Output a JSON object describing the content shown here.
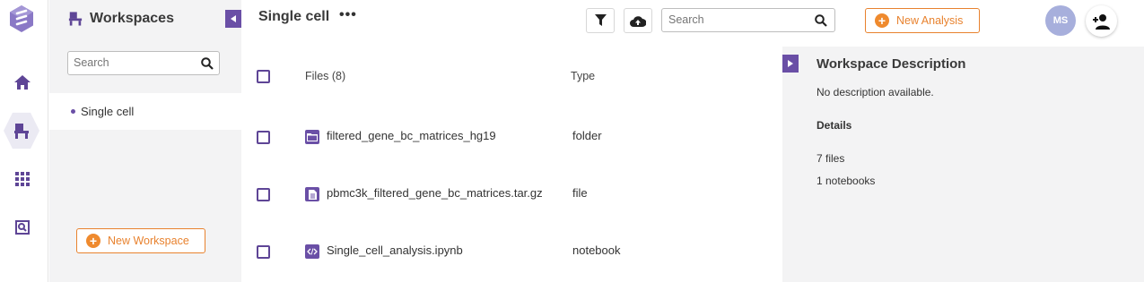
{
  "rail": {
    "items": [
      {
        "icon": "home-icon"
      },
      {
        "icon": "workspaces-icon",
        "active": true
      },
      {
        "icon": "apps-grid-icon"
      },
      {
        "icon": "data-explorer-icon"
      }
    ]
  },
  "workspaces": {
    "title": "Workspaces",
    "search_placeholder": "Search",
    "items": [
      {
        "label": "Single cell",
        "selected": true
      }
    ],
    "new_button": "New Workspace"
  },
  "header": {
    "title": "Single cell",
    "more": "•••",
    "search_placeholder": "Search",
    "new_analysis": "New Analysis",
    "avatar_initials": "MS"
  },
  "files": {
    "columns": {
      "name": "Files (8)",
      "type": "Type"
    },
    "rows": [
      {
        "name": "filtered_gene_bc_matrices_hg19",
        "type": "folder",
        "icon": "folder-icon"
      },
      {
        "name": "pbmc3k_filtered_gene_bc_matrices.tar.gz",
        "type": "file",
        "icon": "file-icon"
      },
      {
        "name": "Single_cell_analysis.ipynb",
        "type": "notebook",
        "icon": "notebook-code-icon"
      }
    ]
  },
  "description": {
    "title": "Workspace Description",
    "text": "No description available.",
    "details_heading": "Details",
    "files_count": "7 files",
    "notebooks_count": "1 notebooks"
  },
  "colors": {
    "accent": "#6a4fa6",
    "brand_orange": "#e8822e",
    "avatar": "#a7afdc"
  }
}
